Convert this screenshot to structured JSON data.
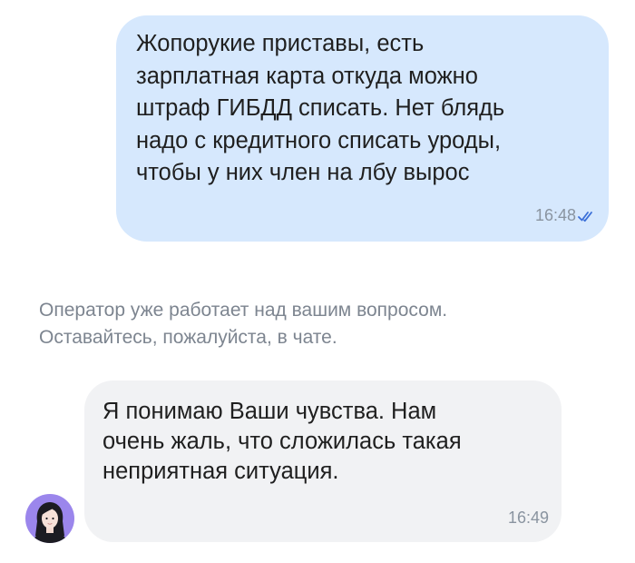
{
  "chat": {
    "messages": [
      {
        "side": "outgoing",
        "text": "Жопорукие приставы, есть\nзарплатная карта откуда можно\nштраф ГИБДД списать. Нет блядь\nнадо с кредитного списать уроды,\nчтобы у них член на лбу вырос",
        "time": "16:48",
        "status_icon": "double-check-icon"
      },
      {
        "side": "system",
        "text": "Оператор уже работает над вашим вопросом.\nОставайтесь, пожалуйста, в чате."
      },
      {
        "side": "incoming",
        "text": "Я понимаю Ваши чувства. Нам\nочень жаль, что сложилась такая\nнеприятная ситуация.",
        "time": "16:49",
        "avatar_icon": "operator-avatar"
      }
    ]
  },
  "colors": {
    "outgoing_bubble": "#d6e8fd",
    "incoming_bubble": "#f1f2f4",
    "avatar_bg": "#9b86ec",
    "check_color": "#3b6fd8"
  }
}
